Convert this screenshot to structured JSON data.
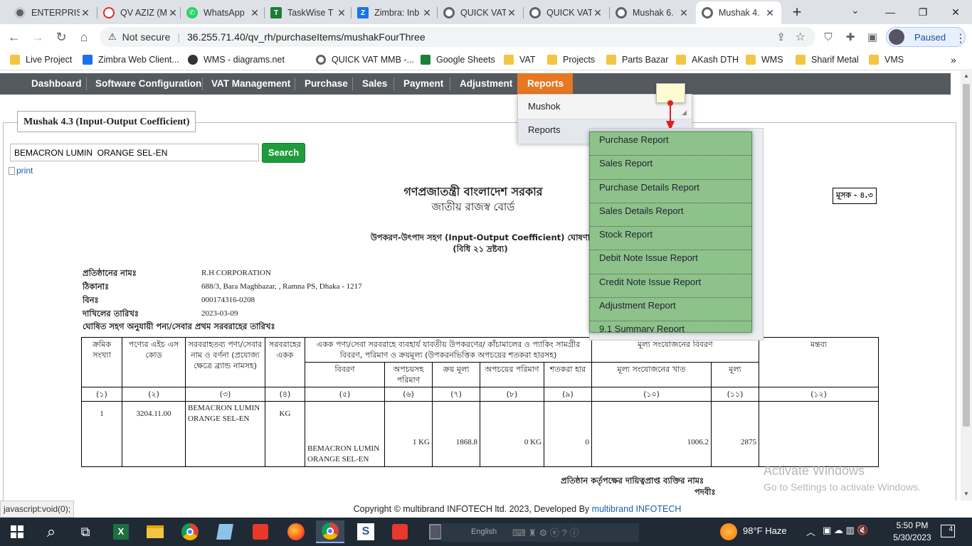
{
  "browser": {
    "tabs": [
      {
        "label": "ENTERPRIS",
        "color": "#5f6368"
      },
      {
        "label": "QV AZIZ (M",
        "color": "#d93025"
      },
      {
        "label": "WhatsApp",
        "color": "#25d366"
      },
      {
        "label": "TaskWise T",
        "color": "#188038"
      },
      {
        "label": "Zimbra: Inb",
        "color": "#1a73e8"
      },
      {
        "label": "QUICK VAT",
        "color": "#5f6368"
      },
      {
        "label": "QUICK VAT",
        "color": "#5f6368"
      },
      {
        "label": "Mushak 6.",
        "color": "#5f6368"
      },
      {
        "label": "Mushak 4.",
        "color": "#5f6368"
      }
    ],
    "not_secure": "Not secure",
    "url": "36.255.71.40/qv_rh/purchaseItems/mushakFourThree",
    "profile": "Paused",
    "bookmarks": [
      "Live Project",
      "Zimbra Web Client...",
      "WMS - diagrams.net",
      "QUICK VAT MMB -...",
      "Google Sheets",
      "VAT",
      "Projects",
      "Parts Bazar",
      "AKash DTH",
      "WMS",
      "Sharif Metal",
      "VMS"
    ]
  },
  "nav": {
    "items": [
      "Dashboard",
      "Software Configuration",
      "VAT Management",
      "Purchase",
      "Sales",
      "Payment",
      "Adjustment",
      "Reports"
    ]
  },
  "reports_menu": {
    "items": [
      "Mushok",
      "Reports"
    ]
  },
  "reports_submenu": {
    "items": [
      "Purchase Report",
      "Sales Report",
      "Purchase Details Report",
      "Sales Details Report",
      "Stock Report",
      "Debit Note Issue Report",
      "Credit Note Issue Report",
      "Adjustment Report",
      "9.1 Summary Report"
    ]
  },
  "panel_title": "Mushak 4.3 (Input-Output Coefficient)",
  "search": {
    "value": "BEMACRON LUMIN  ORANGE SEL-EN",
    "button": "Search"
  },
  "print_alt": "print",
  "report": {
    "gov": "গণপ্রজাতন্ত্রী বাংলাদেশ সরকার",
    "board": "জাতীয় রাজস্ব বোর্ড",
    "mushak_badge": "মূসক - ৪.৩",
    "heading": "উপকরণ-উৎপাদ সহগ (Input-Output Coefficient) ঘোষণা",
    "rule": "(বিধি ২১ দ্রষ্টব্য)",
    "info": [
      {
        "label": "প্রতিষ্ঠানের নামঃ",
        "value": "R.H CORPORATION"
      },
      {
        "label": "ঠিকানাঃ",
        "value": "688/3, Bara Maghbazar, , Ramna PS, Dhaka - 1217"
      },
      {
        "label": "বিনঃ",
        "value": "000174316-0208"
      },
      {
        "label": "দাখিলের তারিখঃ",
        "value": "2023-03-09"
      }
    ],
    "first_supply": "ঘোষিত সহগ অনুযায়ী পন্য/সেবার প্রথম সরবরাহের তারিখঃ",
    "headers": {
      "serial": "ক্রমিক সংখ্যা",
      "hs": "পণ্যের এইচ এস কোড",
      "product": "সরবরাহতব্য পণ্য/সেবার নাম ও বর্ণনা (প্রযোজ্য ক্ষেত্রে ব্র্যান্ড নামসহ)",
      "unit": "সরবরাহের একক",
      "materials": "একক পণ্য/সেবা সরবরাহে ব্যবহার্য যাবতীয় উপকরণের/ কাঁচামালের ও প্যাকিং সামগ্রীর বিবরণ, পরিমাণ ও ক্রয়মূল্য (উপকরনভিত্তিক অপচয়ের শতকরা হারসহ)",
      "value_add": "মূল্য সংযোজনের বিবরণ",
      "remarks": "মন্তব্য",
      "desc": "বিবরণ",
      "qty_waste": "অপচয়সহ পরিমাণ",
      "price": "ক্রয় মূল্য",
      "waste_qty": "অপচয়ের পরিমাণ",
      "percent": "শতকরা হার",
      "va_sector": "মূল্য সংযোজনের খাত",
      "va_value": "মূল্য"
    },
    "col_numbers": [
      "(১)",
      "(২)",
      "(৩)",
      "(৪)",
      "(৫)",
      "(৬)",
      "(৭)",
      "(৮)",
      "(৯)",
      "(১০)",
      "(১১)",
      "(১২)"
    ],
    "row": {
      "serial": "1",
      "hs": "3204.11.00",
      "product": "BEMACRON LUMIN ORANGE SEL-EN",
      "unit": "KG",
      "desc": "BEMACRON LUMIN ORANGE SEL-EN",
      "qty_waste": "1 KG",
      "price": "1868.8",
      "waste_qty": "0 KG",
      "percent": "0",
      "va_sector": "1006.2",
      "va_value": "2875",
      "remarks": ""
    },
    "responsible": "প্রতিষ্ঠান কর্তৃপক্ষের দায়িত্বপ্রাপ্ত ব্যক্তির নামঃ",
    "designation": "পদবীঃ"
  },
  "watermark": {
    "line1": "Activate Windows",
    "line2": "Go to Settings to activate Windows."
  },
  "footer": {
    "text": "Copyright © multibrand INFOTECH ltd. 2023, Developed By",
    "link": "multibrand INFOTECH"
  },
  "status_bar": "javascript:void(0);",
  "taskbar": {
    "lang": "English",
    "weather": "98°F  Haze",
    "time": "5:50 PM",
    "date": "5/30/2023",
    "notif": "4"
  }
}
